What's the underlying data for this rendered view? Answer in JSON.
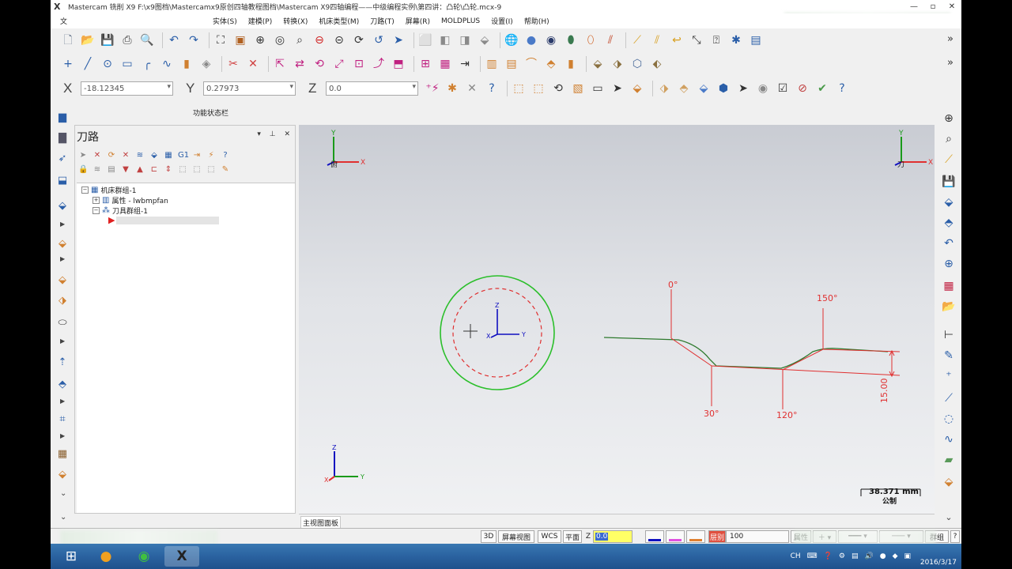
{
  "window": {
    "title": "Mastercam 铣削 X9  F:\\x9图档\\Mastercamx9原创四轴教程图档\\Mastercam X9四轴编程——中级编程实例\\第四讲：凸轮\\凸轮.mcx-9",
    "min": "—",
    "restore": "▫",
    "close": "✕"
  },
  "menu": {
    "items": [
      "文",
      "实体(S)",
      "建模(P)",
      "转换(X)",
      "机床类型(M)",
      "刀路(T)",
      "屏幕(R)",
      "MOLDPLUS",
      "设置(I)",
      "帮助(H)"
    ]
  },
  "coords": {
    "x_label": "X",
    "x_value": "-18.12345",
    "y_label": "Y",
    "y_value": "0.27973",
    "z_label": "Z",
    "z_value": "0.0"
  },
  "status_label": "功能状态栏",
  "panel": {
    "title": "刀路",
    "controls": "▾ ⊥ ✕",
    "tree": {
      "machine_group": "机床群组-1",
      "properties": "属性 - lwbmpfan",
      "toolpath_group": "刀具群组-1"
    }
  },
  "viewport": {
    "top_left_view_label": "俯",
    "top_right_view_label": "刀",
    "axis_x": "X",
    "axis_y": "Y",
    "axis_z": "Z",
    "scale_value": "38.371 mm",
    "scale_unit": "公制",
    "cam_labels": [
      "0°",
      "150°",
      "30°",
      "120°"
    ],
    "dimension": "15.00"
  },
  "view_tab": "主视图面板",
  "statusbar": {
    "mode_3d": "3D",
    "screen_view": "屏幕视图",
    "wcs": "WCS",
    "plane": "平面",
    "z_label": "Z",
    "z_value": "0.0",
    "layer_label": "层别",
    "layer_value": "100",
    "attr_label": "属性",
    "group_label": "群组"
  },
  "taskbar": {
    "lang": "CH",
    "date": "2016/3/17"
  },
  "colors": {
    "accent_green": "#2bbf2b",
    "cam_green": "#2e7a2e",
    "dim_red": "#e03030",
    "axis_blue": "#1010c0"
  }
}
